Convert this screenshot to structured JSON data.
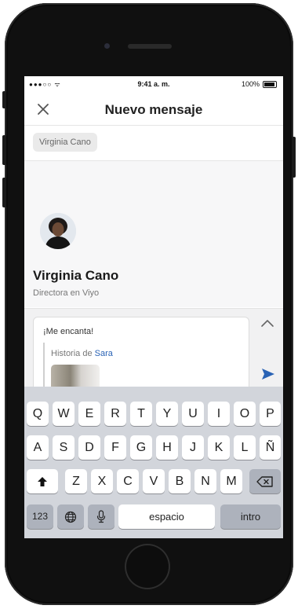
{
  "status_bar": {
    "signal": "●●●○○ ᯤ",
    "time": "9:41 a. m.",
    "battery": "100%"
  },
  "header": {
    "title": "Nuevo mensaje"
  },
  "recipient": {
    "chip_label": "Virginia Cano"
  },
  "profile": {
    "name": "Virginia Cano",
    "role": "Directora en Viyo"
  },
  "message": {
    "text": "¡Me encanta!",
    "quote_prefix": "Historia de ",
    "quote_author": "Sara"
  },
  "keyboard": {
    "row1": [
      "Q",
      "W",
      "E",
      "R",
      "T",
      "Y",
      "U",
      "I",
      "O",
      "P"
    ],
    "row2": [
      "A",
      "S",
      "D",
      "F",
      "G",
      "H",
      "J",
      "K",
      "L",
      "Ñ"
    ],
    "row3": [
      "Z",
      "X",
      "C",
      "V",
      "B",
      "N",
      "M"
    ],
    "numbers_label": "123",
    "space_label": "espacio",
    "return_label": "intro"
  },
  "colors": {
    "accent": "#2a63b5",
    "keyboard_bg": "#d2d5db"
  },
  "icons": {
    "close": "close-icon",
    "collapse": "chevron-up-icon",
    "send": "send-icon",
    "shift": "shift-icon",
    "backspace": "backspace-icon",
    "globe": "globe-icon",
    "mic": "microphone-icon"
  }
}
